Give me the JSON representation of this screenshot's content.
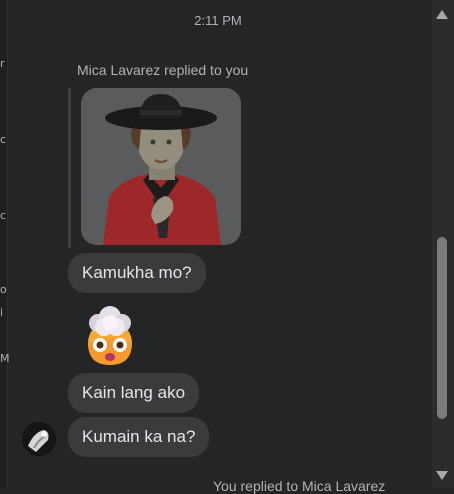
{
  "chat": {
    "timestamp": "2:11 PM",
    "reply_header": "Mica Lavarez replied to you",
    "messages": [
      {
        "text": "Kamukha mo?"
      },
      {
        "emoji": "exploding-head-emoji"
      },
      {
        "text": "Kain lang ako"
      },
      {
        "text": "Kumain ka na?"
      }
    ],
    "bottom_partial": "You replied to Mica Lavarez"
  },
  "left_strip_glyphs": [
    "r",
    "c",
    "c",
    "o",
    "i",
    "M"
  ],
  "icons": {
    "scroll_up": "triangle-up-icon",
    "scroll_down": "triangle-down-icon"
  },
  "colors": {
    "background": "#242526",
    "bubble": "#3a3b3c",
    "text": "#e4e6eb",
    "secondary_text": "#b0b3b8"
  }
}
